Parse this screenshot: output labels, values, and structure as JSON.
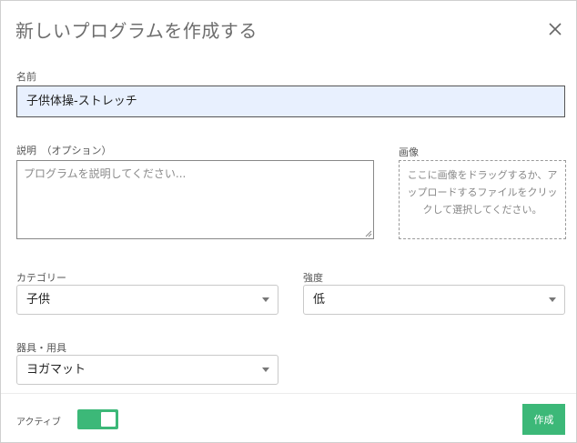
{
  "dialog": {
    "title": "新しいプログラムを作成する"
  },
  "name": {
    "label": "名前",
    "value": "子供体操-ストレッチ"
  },
  "description": {
    "label": "説明　（オプション）",
    "placeholder": "プログラムを説明してください..."
  },
  "image": {
    "label": "画像",
    "dropzone_text": "ここに画像をドラッグするか、アップロードするファイルをクリックして選択してください。"
  },
  "category": {
    "label": "カテゴリー",
    "selected": "子供"
  },
  "intensity": {
    "label": "強度",
    "selected": "低"
  },
  "equipment": {
    "label": "器具・用具",
    "selected": "ヨガマット"
  },
  "footer": {
    "active_label": "アクティブ",
    "active_on": true,
    "create_label": "作成"
  },
  "colors": {
    "accent": "#3cb878",
    "input_bg": "#e8f0fe"
  }
}
